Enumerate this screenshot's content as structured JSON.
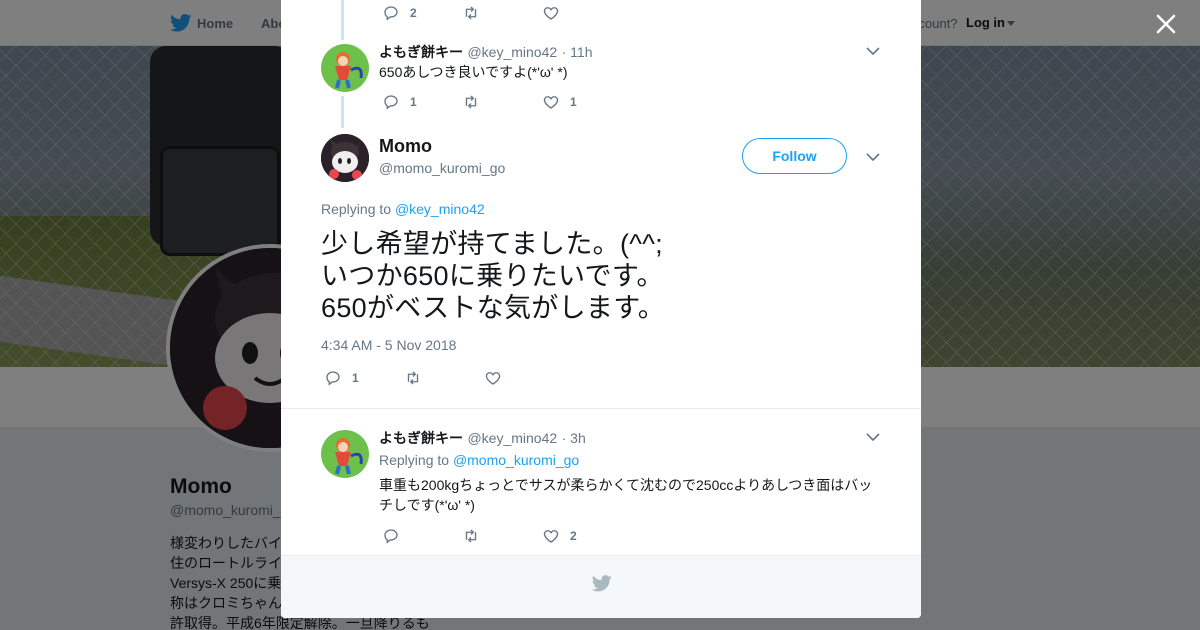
{
  "nav": {
    "home_label": "Home",
    "about_label": "Abo",
    "account_prompt": "ccount?",
    "login_label": "Log in"
  },
  "profile": {
    "name": "Momo",
    "handle": "@momo_kuromi_",
    "bio": "様変わりしたバイ\n住のロートルライ\nVersys-X 250に乗\n称はクロミちゃん\n許取得。平成6年限定解除。一旦降りるも"
  },
  "thread": {
    "prev_reply": {
      "reply_count": "2",
      "like_count": ""
    },
    "parent": {
      "name": "よもぎ餅キー",
      "handle": "@key_mino42",
      "time": "· 11h",
      "text": "650あしつき良いですよ(*'ω' *)",
      "reply_count": "1",
      "like_count": "1"
    },
    "main": {
      "name": "Momo",
      "handle": "@momo_kuromi_go",
      "follow_label": "Follow",
      "replying_prefix": "Replying to",
      "replying_to": "@key_mino42",
      "text": "少し希望が持てました。(^^;\nいつか650に乗りたいです。\n650がベストな気がします。",
      "timestamp": "4:34 AM - 5 Nov 2018",
      "reply_count": "1"
    },
    "reply": {
      "name": "よもぎ餅キー",
      "handle": "@key_mino42",
      "time": "· 3h",
      "replying_prefix": "Replying to",
      "replying_to": "@momo_kuromi_go",
      "text": "車重も200kgちょっとでサスが柔らかくて沈むので250ccよりあしつき面はバッチしです(*'ω' *)",
      "like_count": "2"
    }
  },
  "icons": {
    "brand": "twitter-bird-icon",
    "close": "close-icon",
    "reply": "reply-icon",
    "retweet": "retweet-icon",
    "like": "heart-icon",
    "caret": "chevron-down-icon"
  },
  "colors": {
    "accent": "#1da1f2",
    "thread_line": "#cce5f6",
    "muted": "#657786"
  }
}
